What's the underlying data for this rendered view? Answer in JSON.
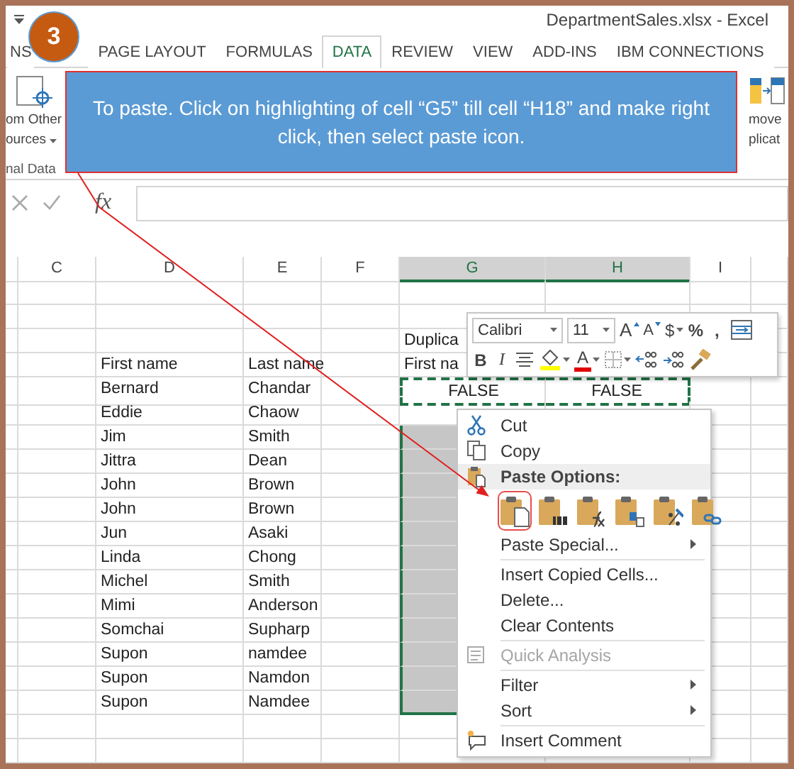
{
  "window": {
    "title": "DepartmentSales.xlsx - Excel"
  },
  "tabs": [
    {
      "label": "NS",
      "selected": false
    },
    {
      "label": "PAGE LAYOUT",
      "selected": false
    },
    {
      "label": "FORMULAS",
      "selected": false
    },
    {
      "label": "DATA",
      "selected": true
    },
    {
      "label": "REVIEW",
      "selected": false
    },
    {
      "label": "VIEW",
      "selected": false
    },
    {
      "label": "ADD-INS",
      "selected": false
    },
    {
      "label": "IBM CONNECTIONS",
      "selected": false
    }
  ],
  "ribbon": {
    "left_group": {
      "lines": [
        "om Other",
        "ources"
      ],
      "group_label": "nal Data"
    },
    "right_group": {
      "lines": [
        "move",
        "plicat"
      ]
    }
  },
  "callout": {
    "step": "3",
    "text": "To paste. Click on highlighting of cell “G5” till cell “H18” and make right click, then select paste icon."
  },
  "formula_bar": {
    "function_label": "fx"
  },
  "columns": [
    {
      "label": "C",
      "selected": false
    },
    {
      "label": "D",
      "selected": false
    },
    {
      "label": "E",
      "selected": false
    },
    {
      "label": "F",
      "selected": false
    },
    {
      "label": "G",
      "selected": true
    },
    {
      "label": "H",
      "selected": true
    },
    {
      "label": "I",
      "selected": false
    }
  ],
  "rows": [
    {
      "selected": false,
      "copied": false
    },
    {
      "selected": false,
      "copied": false
    },
    {
      "cells": {
        "G": "Duplica"
      },
      "selected": false,
      "copied": false
    },
    {
      "cells": {
        "D": "First name",
        "E": "Last name",
        "G": "First na"
      },
      "selected": false,
      "copied": false
    },
    {
      "cells": {
        "D": "Bernard",
        "E": "Chandar",
        "G": "FALSE",
        "H": "FALSE"
      },
      "selected": false,
      "copied": true
    },
    {
      "cells": {
        "D": "Eddie",
        "E": "Chaow"
      },
      "selected": false,
      "copied": false
    },
    {
      "cells": {
        "D": "Jim",
        "E": "Smith"
      },
      "selected": true,
      "copied": false
    },
    {
      "cells": {
        "D": "Jittra",
        "E": "Dean"
      },
      "selected": true,
      "copied": false
    },
    {
      "cells": {
        "D": "John",
        "E": "Brown"
      },
      "selected": true,
      "copied": false
    },
    {
      "cells": {
        "D": "John",
        "E": "Brown"
      },
      "selected": true,
      "copied": false
    },
    {
      "cells": {
        "D": "Jun",
        "E": "Asaki"
      },
      "selected": true,
      "copied": false
    },
    {
      "cells": {
        "D": "Linda",
        "E": "Chong"
      },
      "selected": true,
      "copied": false
    },
    {
      "cells": {
        "D": "Michel",
        "E": "Smith"
      },
      "selected": true,
      "copied": false
    },
    {
      "cells": {
        "D": "Mimi",
        "E": "Anderson"
      },
      "selected": true,
      "copied": false
    },
    {
      "cells": {
        "D": "Somchai",
        "E": "Supharp"
      },
      "selected": true,
      "copied": false
    },
    {
      "cells": {
        "D": "Supon",
        "E": "namdee"
      },
      "selected": true,
      "copied": false
    },
    {
      "cells": {
        "D": "Supon",
        "E": "Namdon"
      },
      "selected": true,
      "copied": false
    },
    {
      "cells": {
        "D": "Supon",
        "E": "Namdee"
      },
      "selected": true,
      "copied": false
    },
    {
      "selected": false,
      "copied": false
    },
    {
      "selected": false,
      "copied": false
    }
  ],
  "mini_toolbar": {
    "font_row": [
      {
        "kind": "font-name",
        "value": "Calibri"
      },
      {
        "kind": "font-size",
        "value": "11"
      },
      {
        "kind": "grow-font",
        "label": "A"
      },
      {
        "kind": "shrink-font",
        "label": "A"
      },
      {
        "kind": "text-menu",
        "label": "$"
      },
      {
        "kind": "text",
        "label": "%"
      },
      {
        "kind": "text",
        "label": ","
      },
      {
        "kind": "wrap-text"
      }
    ],
    "format_row": [
      {
        "kind": "bold",
        "label": "B"
      },
      {
        "kind": "italic",
        "label": "I"
      },
      {
        "kind": "center-align"
      },
      {
        "kind": "fill-color"
      },
      {
        "kind": "font-color",
        "label": "A"
      },
      {
        "kind": "borders"
      },
      {
        "kind": "increase-decimal"
      },
      {
        "kind": "decrease-decimal"
      },
      {
        "kind": "format-painter"
      }
    ]
  },
  "context_menu": [
    {
      "kind": "cut",
      "label": "Cut",
      "disabled": false,
      "submenu": false
    },
    {
      "kind": "copy",
      "label": "Copy",
      "disabled": false,
      "submenu": false
    },
    {
      "kind": "paste-header",
      "label": "Paste Options:"
    },
    {
      "kind": "paste-options",
      "options": [
        {
          "selected": true
        },
        {
          "selected": false
        },
        {
          "selected": false
        },
        {
          "selected": false
        },
        {
          "selected": false
        },
        {
          "selected": false
        }
      ]
    },
    {
      "kind": "command",
      "label": "Paste Special...",
      "disabled": false,
      "submenu": true
    },
    {
      "kind": "separator"
    },
    {
      "kind": "command",
      "label": "Insert Copied Cells...",
      "disabled": false,
      "submenu": false
    },
    {
      "kind": "command",
      "label": "Delete...",
      "disabled": false,
      "submenu": false
    },
    {
      "kind": "command",
      "label": "Clear Contents",
      "disabled": false,
      "submenu": false
    },
    {
      "kind": "separator"
    },
    {
      "kind": "quick-analysis",
      "label": "Quick Analysis",
      "disabled": true,
      "submenu": false
    },
    {
      "kind": "separator"
    },
    {
      "kind": "command",
      "label": "Filter",
      "disabled": false,
      "submenu": true
    },
    {
      "kind": "command",
      "label": "Sort",
      "disabled": false,
      "submenu": true
    },
    {
      "kind": "separator"
    },
    {
      "kind": "comment",
      "label": "Insert Comment",
      "disabled": false,
      "submenu": false
    }
  ]
}
